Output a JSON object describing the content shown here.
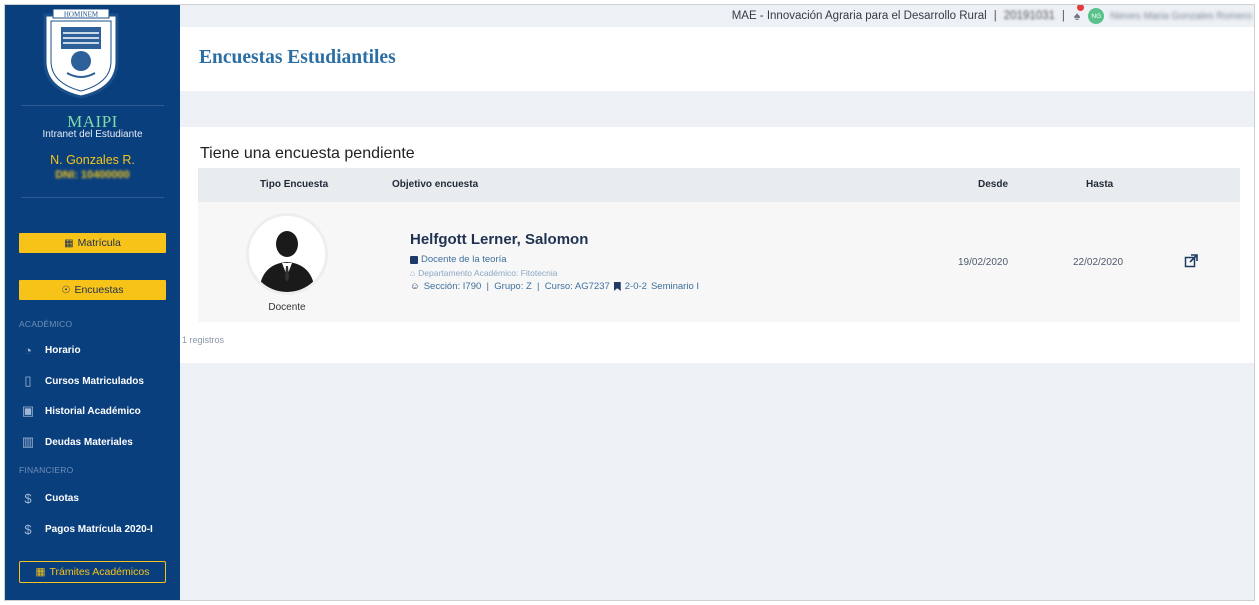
{
  "header": {
    "program": "MAE - Innovación Agraria para el Desarrollo Rural",
    "student_code": "20191031",
    "avatar_initials": "NG",
    "user_fullname": "Nieves Maria Gonzales Romero"
  },
  "sidebar": {
    "app_name": "MAIPI",
    "app_subtitle": "Intranet del Estudiante",
    "user_short": "N. Gonzales R.",
    "user_dni": "DNI: 10400000",
    "buttons": {
      "matricula": "Matrícula",
      "encuestas": "Encuestas",
      "tramites": "Trámites Académicos"
    },
    "sections": {
      "academico": "ACADÉMICO",
      "financiero": "FINANCIERO"
    },
    "items": {
      "horario": "Horario",
      "cursos": "Cursos Matriculados",
      "historial": "Historial Académico",
      "deudas": "Deudas Materiales",
      "cuotas": "Cuotas",
      "pagos": "Pagos Matrícula 2020-I"
    }
  },
  "page": {
    "title": "Encuestas Estudiantiles",
    "card_title": "Tiene una encuesta pendiente",
    "table": {
      "headers": {
        "tipo": "Tipo Encuesta",
        "objetivo": "Objetivo encuesta",
        "desde": "Desde",
        "hasta": "Hasta"
      },
      "row": {
        "tipo_label": "Docente",
        "person": "Helfgott Lerner, Salomon",
        "role": "Docente de la teoría",
        "department": "Departamento Académico: Fitotecnia",
        "section_info": "Sección: I790  |  Grupo: Z  |  Curso: AG7237",
        "course_code": "2-0-2",
        "course_name": "Seminario I",
        "desde": "19/02/2020",
        "hasta": "22/02/2020"
      }
    },
    "records": "1 registros"
  },
  "colors": {
    "sidebar_bg": "#0a3f7e",
    "accent_yellow": "#f7c318",
    "title_blue": "#2b6ea3"
  }
}
